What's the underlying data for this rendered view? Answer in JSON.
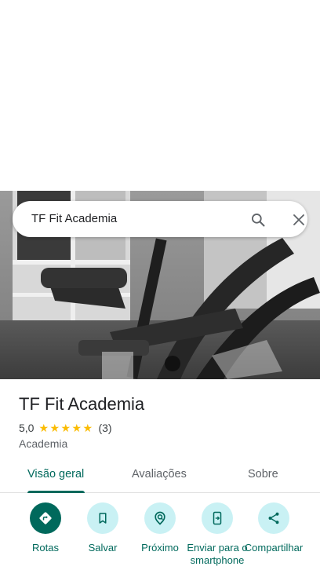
{
  "search": {
    "query": "TF Fit Academia",
    "search_icon": "search-icon",
    "clear_icon": "close-icon"
  },
  "hero": {
    "image": "gym-equipment-photo"
  },
  "place": {
    "name": "TF Fit Academia",
    "rating": "5,0",
    "stars": 5,
    "review_count": "(3)",
    "category": "Academia"
  },
  "tabs": [
    {
      "label": "Visão geral",
      "active": true
    },
    {
      "label": "Avaliações",
      "active": false
    },
    {
      "label": "Sobre",
      "active": false
    }
  ],
  "actions": [
    {
      "label": "Rotas",
      "icon": "directions-icon"
    },
    {
      "label": "Salvar",
      "icon": "bookmark-icon"
    },
    {
      "label": "Próximo",
      "icon": "nearby-icon"
    },
    {
      "label": "Enviar para o smartphone",
      "icon": "send-to-phone-icon"
    },
    {
      "label": "Compartilhar",
      "icon": "share-icon"
    }
  ],
  "colors": {
    "accent": "#00695c",
    "action_bg": "#c9f1f4",
    "star": "#fbbc04"
  }
}
